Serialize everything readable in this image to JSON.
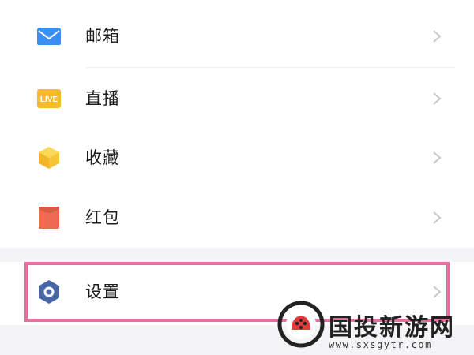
{
  "menu": {
    "items": [
      {
        "label": "邮箱",
        "icon": "mail-icon",
        "color": "#3b8ff0"
      },
      {
        "label": "直播",
        "icon": "live-icon",
        "color": "#f6bb2c",
        "icon_text": "LIVE"
      },
      {
        "label": "收藏",
        "icon": "favorites-cube-icon",
        "color": "#f7c132"
      },
      {
        "label": "红包",
        "icon": "red-envelope-icon",
        "color": "#ee6a50"
      }
    ],
    "settings": {
      "label": "设置",
      "icon": "settings-hexagon-icon",
      "color": "#4866a6"
    }
  },
  "highlight": {
    "color": "#e46fa0"
  },
  "watermark": {
    "title": "国投新游网",
    "url": "www.sxsgytr.com"
  }
}
